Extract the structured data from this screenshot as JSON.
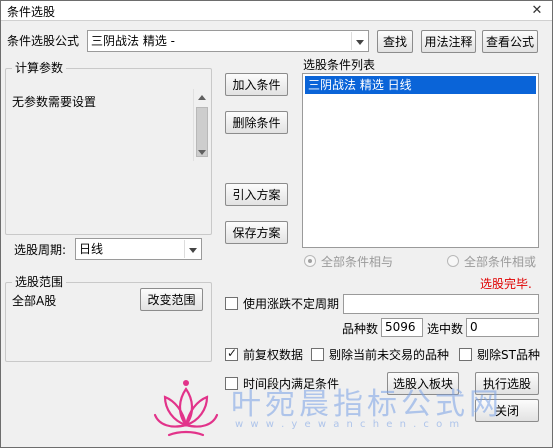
{
  "window": {
    "title": "条件选股",
    "close_label": "✕"
  },
  "formula": {
    "label": "条件选股公式",
    "value": "三阴战法 精选 -"
  },
  "top_buttons": {
    "find": "查找",
    "usage": "用法注释",
    "view": "查看公式"
  },
  "params": {
    "group_label": "计算参数",
    "text": "无参数需要设置"
  },
  "period": {
    "label": "选股周期:",
    "value": "日线"
  },
  "mid_buttons": {
    "add": "加入条件",
    "delete": "删除条件",
    "import": "引入方案",
    "save": "保存方案"
  },
  "cond_list": {
    "label": "选股条件列表",
    "items": [
      "三阴战法 精选  日线"
    ]
  },
  "logic": {
    "and_label": "全部条件相与",
    "or_label": "全部条件相或"
  },
  "status": {
    "text": "选股完毕.",
    "color": "#e00000"
  },
  "range": {
    "group_label": "选股范围",
    "value": "全部A股",
    "change_button": "改变范围"
  },
  "options": {
    "limit_period": {
      "label": "使用涨跌不定周期",
      "checked": false
    },
    "adjusted": {
      "label": "前复权数据",
      "checked": true
    },
    "exclude_untraded": {
      "label": "剔除当前未交易的品种",
      "checked": false
    },
    "exclude_st": {
      "label": "剔除ST品种",
      "checked": false
    },
    "time_segment": {
      "label": "时间段内满足条件",
      "checked": false
    }
  },
  "counts": {
    "total_label": "品种数",
    "total_value": "5096",
    "selected_label": "选中数",
    "selected_value": "0"
  },
  "bottom_buttons": {
    "to_block": "选股入板块",
    "execute": "执行选股",
    "close": "关闭"
  },
  "watermark": {
    "text": "叶宛晨指标公式网",
    "url": "w w w . y e w a n c h e n . c o m"
  }
}
